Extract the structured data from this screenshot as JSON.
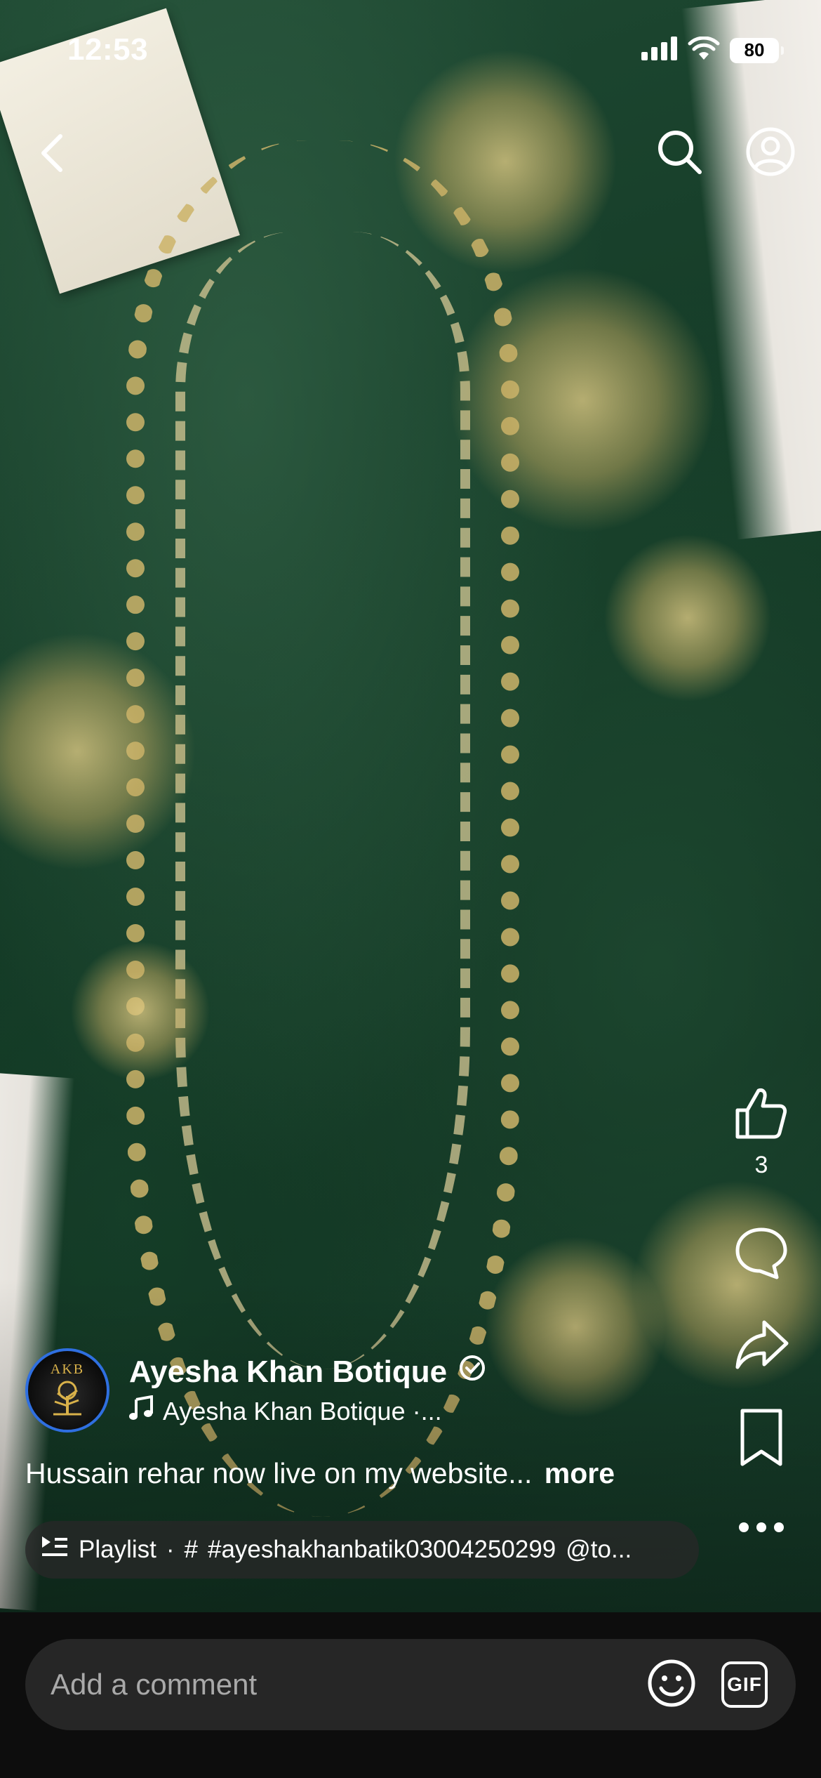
{
  "status_bar": {
    "time": "12:53",
    "battery": "80"
  },
  "channel": {
    "name": "Ayesha Khan Botique",
    "subtitle": "Ayesha Khan Botique ·...",
    "avatar_text": "AKB",
    "avatar_ring_color": "#2f6fe0"
  },
  "caption": {
    "text": "Hussain rehar now live on my website...",
    "more_label": "more"
  },
  "playlist": {
    "label": "Playlist",
    "separator": "·",
    "hash": "#",
    "hashtag": "#ayeshakhanbatik03004250299",
    "mention": "@to..."
  },
  "actions": {
    "like_count": "3"
  },
  "comment": {
    "placeholder": "Add a comment",
    "gif_label": "GIF"
  },
  "icons": [
    "back-icon",
    "search-icon",
    "profile-icon",
    "like-icon",
    "comment-icon",
    "share-icon",
    "save-icon",
    "more-icon",
    "emoji-icon",
    "gif-icon",
    "playlist-icon",
    "music-note-icon",
    "verified-icon"
  ]
}
